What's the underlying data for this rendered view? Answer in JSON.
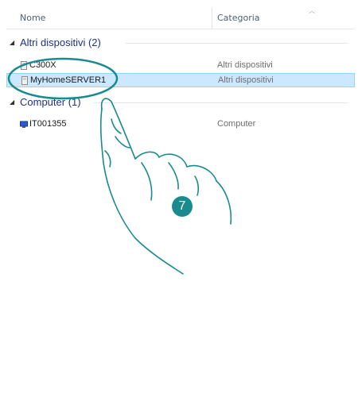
{
  "header": {
    "col_name": "Nome",
    "col_category": "Categoria"
  },
  "groups": [
    {
      "label": "Altri dispositivi (2)",
      "items": [
        {
          "name": "C300X",
          "category": "Altri dispositivi",
          "icon": "device-icon"
        },
        {
          "name": "MyHomeSERVER1",
          "category": "Altri dispositivi",
          "icon": "device-icon",
          "selected": true
        }
      ]
    },
    {
      "label": "Computer (1)",
      "items": [
        {
          "name": "IT001355",
          "category": "Computer",
          "icon": "computer-icon"
        }
      ]
    }
  ],
  "annotation": {
    "step_number": "7",
    "accent_color": "#1a8a8f"
  }
}
